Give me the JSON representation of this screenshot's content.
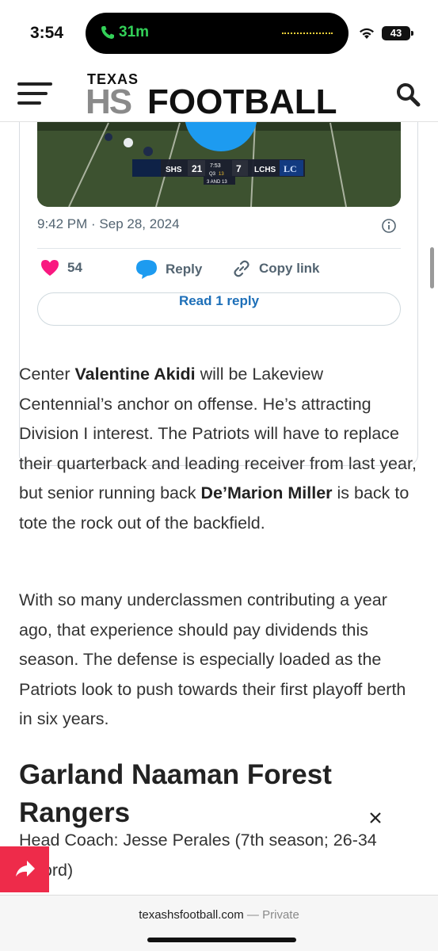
{
  "status": {
    "time": "3:54",
    "call_timer": "31m",
    "battery": "43"
  },
  "header": {
    "logo_top": "TEXAS",
    "logo_hs": "HS",
    "logo_football": "FOOTBALL"
  },
  "tweet": {
    "scoreboard": {
      "home_team": "SHS",
      "home_score": "21",
      "clock": "7:53",
      "quarter": "Q3",
      "timeouts": "13",
      "down": "3 AND 13",
      "away_score": "7",
      "away_team": "LCHS",
      "away_logo": "LC"
    },
    "timestamp": "9:42 PM · Sep 28, 2024",
    "likes": "54",
    "reply_label": "Reply",
    "copy_link_label": "Copy link",
    "read_replies_label": "Read 1 reply"
  },
  "article": {
    "p1": {
      "before": "Center ",
      "name1": "Valentine Akidi",
      "middle": " will be Lakeview Centennial’s anchor on offense. He’s attracting Division I interest. The Patriots will have to replace their quarterback and leading receiver from last year, but senior running back ",
      "name2": "De’Marion Miller",
      "after": " is back to tote the rock out of the backfield."
    },
    "p2": "With so many underclassmen contributing a year ago, that experience should pay dividends this season. The defense is especially loaded as the Patriots look to push towards their first playoff berth in six years.",
    "section_title": "Garland Naaman Forest Rangers",
    "coach_line": "Head Coach: Jesse Perales (7th season; 26-34 record)"
  },
  "browser": {
    "domain": "texashsfootball.com",
    "separator": " — ",
    "mode": "Private"
  },
  "colors": {
    "like_heart": "#f91880",
    "reply_bubble": "#1d9bf0",
    "link_blue": "#1d6fb8",
    "share_red": "#ee2b4a"
  }
}
